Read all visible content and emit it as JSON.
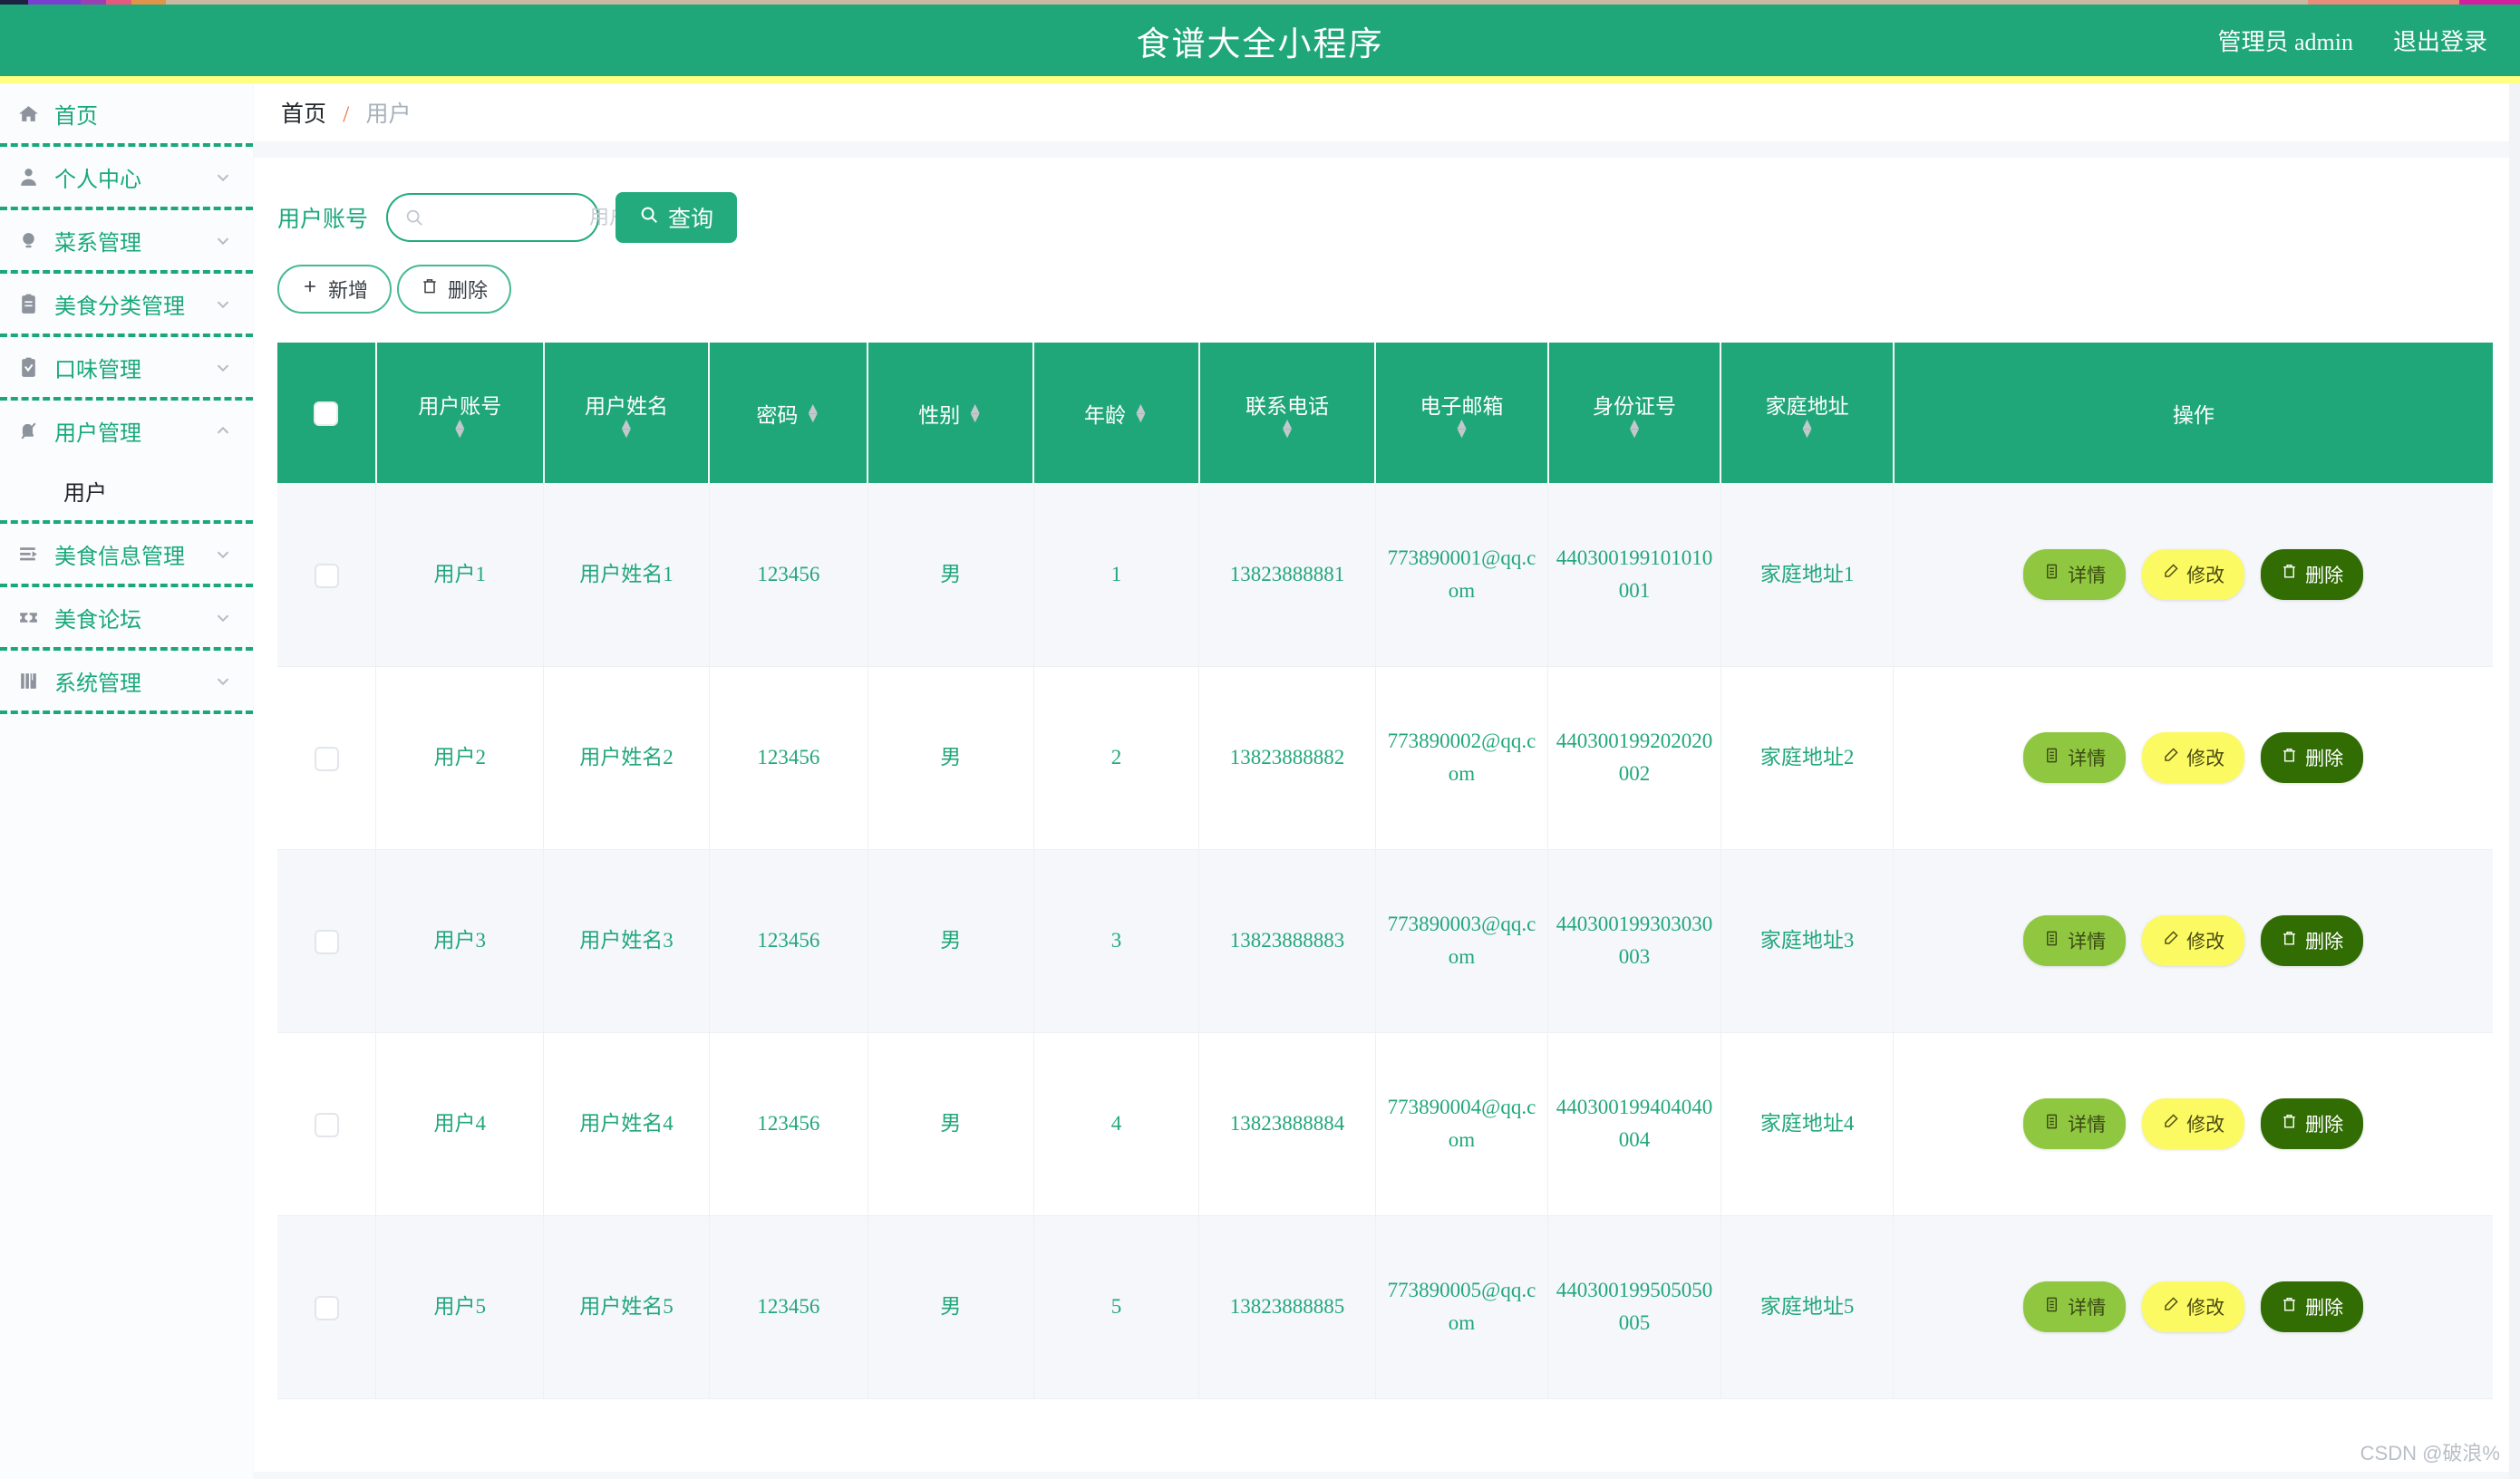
{
  "top_strip_colors": [
    "#1d2240",
    "#7a3fd1",
    "#9c3fb5",
    "#e8577f",
    "#e0944a",
    "#c9b9a3",
    "#e98c7a",
    "#d11fa0"
  ],
  "header": {
    "title": "食谱大全小程序",
    "admin_label": "管理员 admin",
    "logout_label": "退出登录",
    "bg_color": "#20a779",
    "accent_bar_color": "#ffff80"
  },
  "sidebar": {
    "items": [
      {
        "label": "首页",
        "icon": "home-icon",
        "chevron": "none"
      },
      {
        "label": "个人中心",
        "icon": "user-icon",
        "chevron": "down"
      },
      {
        "label": "菜系管理",
        "icon": "bulb-icon",
        "chevron": "down"
      },
      {
        "label": "美食分类管理",
        "icon": "clipboard-icon",
        "chevron": "down"
      },
      {
        "label": "口味管理",
        "icon": "clipboard-check-icon",
        "chevron": "down"
      },
      {
        "label": "用户管理",
        "icon": "bell-off-icon",
        "chevron": "up"
      },
      {
        "label": "美食信息管理",
        "icon": "list-icon",
        "chevron": "down"
      },
      {
        "label": "美食论坛",
        "icon": "ticket-icon",
        "chevron": "down"
      },
      {
        "label": "系统管理",
        "icon": "book-icon",
        "chevron": "down"
      }
    ],
    "submenu": {
      "parent_index": 5,
      "label": "用户"
    }
  },
  "breadcrumb": {
    "home": "首页",
    "separator": "/",
    "current": "用户"
  },
  "search": {
    "label": "用户账号",
    "placeholder": "用户账号",
    "value": "",
    "query_button": "查询",
    "query_icon": "search-icon"
  },
  "toolbar": {
    "add_label": "新增",
    "add_icon": "plus-icon",
    "delete_label": "删除",
    "delete_icon": "trash-icon"
  },
  "table": {
    "columns": [
      {
        "key": "checkbox",
        "label": "",
        "sortable": false
      },
      {
        "key": "account",
        "label": "用户账号",
        "sortable": true
      },
      {
        "key": "name",
        "label": "用户姓名",
        "sortable": true
      },
      {
        "key": "password",
        "label": "密码",
        "sortable": true
      },
      {
        "key": "gender",
        "label": "性别",
        "sortable": true
      },
      {
        "key": "age",
        "label": "年龄",
        "sortable": true
      },
      {
        "key": "phone",
        "label": "联系电话",
        "sortable": true
      },
      {
        "key": "email",
        "label": "电子邮箱",
        "sortable": true
      },
      {
        "key": "idcard",
        "label": "身份证号",
        "sortable": true
      },
      {
        "key": "address",
        "label": "家庭地址",
        "sortable": true
      },
      {
        "key": "ops",
        "label": "操作",
        "sortable": false
      }
    ],
    "rows": [
      {
        "account": "用户1",
        "name": "用户姓名1",
        "password": "123456",
        "gender": "男",
        "age": "1",
        "phone": "13823888881",
        "email": "773890001@qq.com",
        "idcard": "440300199101010001",
        "address": "家庭地址1"
      },
      {
        "account": "用户2",
        "name": "用户姓名2",
        "password": "123456",
        "gender": "男",
        "age": "2",
        "phone": "13823888882",
        "email": "773890002@qq.com",
        "idcard": "440300199202020002",
        "address": "家庭地址2"
      },
      {
        "account": "用户3",
        "name": "用户姓名3",
        "password": "123456",
        "gender": "男",
        "age": "3",
        "phone": "13823888883",
        "email": "773890003@qq.com",
        "idcard": "440300199303030003",
        "address": "家庭地址3"
      },
      {
        "account": "用户4",
        "name": "用户姓名4",
        "password": "123456",
        "gender": "男",
        "age": "4",
        "phone": "13823888884",
        "email": "773890004@qq.com",
        "idcard": "440300199404040004",
        "address": "家庭地址4"
      },
      {
        "account": "用户5",
        "name": "用户姓名5",
        "password": "123456",
        "gender": "男",
        "age": "5",
        "phone": "13823888885",
        "email": "773890005@qq.com",
        "idcard": "440300199505050005",
        "address": "家庭地址5"
      }
    ],
    "ops": {
      "detail_label": "详情",
      "detail_icon": "doc-icon",
      "detail_color": "#8fc740",
      "edit_label": "修改",
      "edit_icon": "pencil-icon",
      "edit_color": "#fcfa63",
      "delete_label": "删除",
      "delete_icon": "trash-icon",
      "delete_color": "#316d03"
    }
  },
  "watermark": "CSDN @破浪%"
}
